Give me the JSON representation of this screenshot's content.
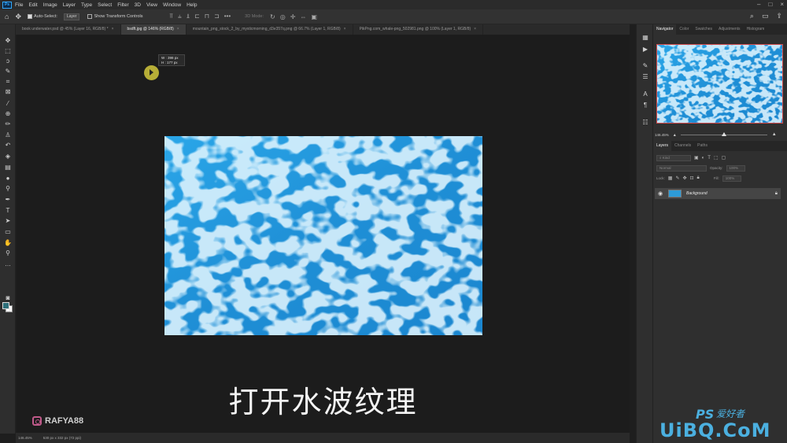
{
  "app": {
    "logo_label": "Ps"
  },
  "menu": [
    "File",
    "Edit",
    "Image",
    "Layer",
    "Type",
    "Select",
    "Filter",
    "3D",
    "View",
    "Window",
    "Help"
  ],
  "options_bar": {
    "auto_select_label": "Auto-Select:",
    "auto_select_target": "Layer",
    "transform_controls_label": "Show Transform Controls",
    "mode_3d_label": "3D Mode:"
  },
  "tabs": [
    {
      "label": "book underwater.psd @ 45% (Layer 16, RGB/8) *",
      "active": false
    },
    {
      "label": "bsdft.jpg @ 146% (RGB/8)",
      "active": true
    },
    {
      "label": "mountain_png_stock_2_by_mysticmorning_d3e357q.png @ 66.7% (Layer 1, RGB/8)",
      "active": false
    },
    {
      "label": "PikPng.com_whale-png_502981.png @ 100% (Layer 1, RGB/8)",
      "active": false
    }
  ],
  "tab_close_glyph": "×",
  "tooltip": {
    "width": "W : 398 px",
    "height": "H : 177 px"
  },
  "subtitle": "打开水波纹理",
  "watermark": {
    "handle": "RAFYA88"
  },
  "status": {
    "zoom": "146.45%",
    "doc_size": "530 px x 332 px (72 ppi)"
  },
  "navigator": {
    "tabs": [
      "Navigator",
      "Color",
      "Swatches",
      "Adjustments",
      "Histogram"
    ],
    "zoom_value": "146.45%"
  },
  "layers_panel": {
    "tabs": [
      "Layers",
      "Channels",
      "Paths"
    ],
    "kind_filter": "Kind",
    "blend_mode": "Normal",
    "opacity_label": "Opacity:",
    "opacity_value": "100%",
    "lock_label": "Lock:",
    "fill_label": "Fill:",
    "fill_value": "100%",
    "layers": [
      {
        "name": "Background",
        "visible": true,
        "locked": true
      }
    ]
  },
  "corner_logo": {
    "ps_text": "PS",
    "ps_text2": "爱好者",
    "site": "UiBQ.CoM"
  },
  "colors": {
    "foreground": "#2d6f7a",
    "background": "#ffffff",
    "water_base": "#1f8fd6",
    "water_highlight": "#bfeaff",
    "cursor_highlight": "#d2c83c"
  },
  "icons": {
    "home": "home-icon",
    "move": "move-icon",
    "search": "search-icon",
    "eye": "eye-icon",
    "lock": "lock-icon"
  }
}
